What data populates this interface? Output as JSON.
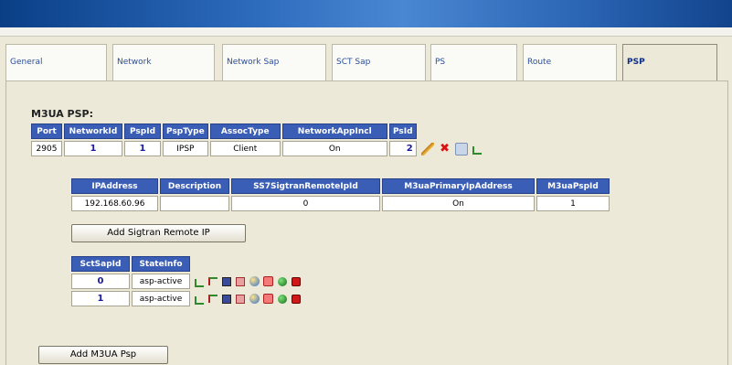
{
  "tabs": [
    {
      "label": "General"
    },
    {
      "label": "Network"
    },
    {
      "label": "Network Sap"
    },
    {
      "label": "SCT Sap"
    },
    {
      "label": "PS"
    },
    {
      "label": "Route"
    },
    {
      "label": "PSP"
    }
  ],
  "section_title": "M3UA PSP:",
  "psp_table": {
    "headers": [
      "Port",
      "NetworkId",
      "PspId",
      "PspType",
      "AssocType",
      "NetworkAppIncl",
      "PsId"
    ],
    "row": [
      "2905",
      "1",
      "1",
      "IPSP",
      "Client",
      "On",
      "2"
    ]
  },
  "ip_table": {
    "headers": [
      "IPAddress",
      "Description",
      "SS7SigtranRemoteIpId",
      "M3uaPrimaryIpAddress",
      "M3uaPspId"
    ],
    "row": [
      "192.168.60.96",
      "",
      "0",
      "On",
      "1"
    ]
  },
  "buttons": {
    "add_sigtran_remote_ip": "Add Sigtran Remote IP",
    "add_m3ua_psp": "Add M3UA Psp"
  },
  "sctsap_table": {
    "headers": [
      "SctSapId",
      "StateInfo"
    ],
    "rows": [
      {
        "id": "0",
        "state": "asp-active"
      },
      {
        "id": "1",
        "state": "asp-active"
      }
    ]
  }
}
